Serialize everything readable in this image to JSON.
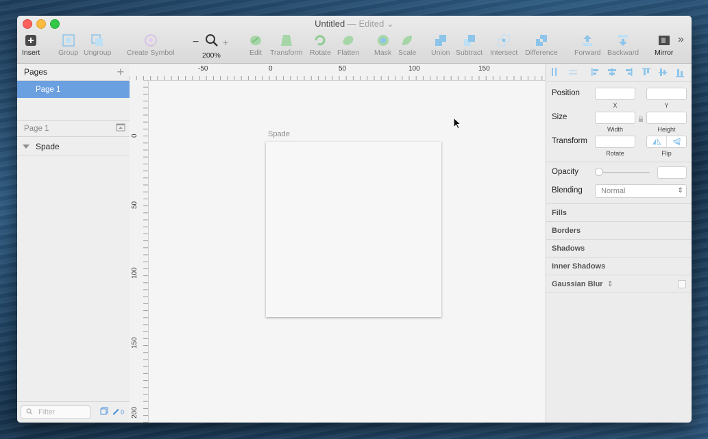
{
  "window": {
    "title": "Untitled",
    "title_status": "— Edited"
  },
  "toolbar": {
    "insert": "Insert",
    "group": "Group",
    "ungroup": "Ungroup",
    "create_symbol": "Create Symbol",
    "zoom_minus": "−",
    "zoom_plus": "+",
    "zoom_level": "200%",
    "edit": "Edit",
    "transform": "Transform",
    "rotate": "Rotate",
    "flatten": "Flatten",
    "mask": "Mask",
    "scale": "Scale",
    "union": "Union",
    "subtract": "Subtract",
    "intersect": "Intersect",
    "difference": "Difference",
    "forward": "Forward",
    "backward": "Backward",
    "mirror": "Mirror",
    "more": "»"
  },
  "sidebar": {
    "pages_title": "Pages",
    "pages": [
      "Page 1"
    ],
    "layers_header": "Page 1",
    "layers": [
      "Spade"
    ],
    "filter_placeholder": "Filter",
    "edited_count": "0"
  },
  "rulers": {
    "top_labels": [
      "-50",
      "0",
      "50",
      "100",
      "150"
    ],
    "left_labels": [
      "0",
      "50",
      "100",
      "150",
      "200"
    ]
  },
  "canvas": {
    "artboard_name": "Spade"
  },
  "inspector": {
    "position": "Position",
    "x": "X",
    "y": "Y",
    "size": "Size",
    "width": "Width",
    "height": "Height",
    "transform": "Transform",
    "rotate": "Rotate",
    "flip": "Flip",
    "opacity": "Opacity",
    "blending": "Blending",
    "blending_value": "Normal",
    "sections": [
      "Fills",
      "Borders",
      "Shadows",
      "Inner Shadows",
      "Gaussian Blur"
    ]
  },
  "colors": {
    "accent": "#6a9fe0",
    "icon_green": "#9fd3a1",
    "icon_blue": "#8cc4ea"
  }
}
